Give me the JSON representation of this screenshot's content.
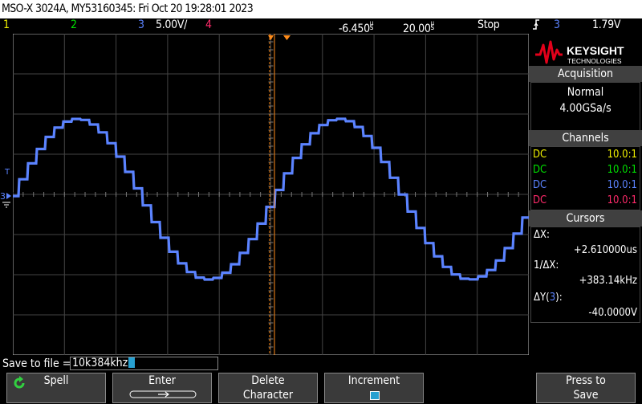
{
  "header": {
    "title": "MSO-X 3024A, MY53160345: Fri Oct 20 19:28:01 2023"
  },
  "status": {
    "ch1": "1",
    "ch2": "2",
    "ch3": "3",
    "ch3_scale": "5.00V/",
    "ch4": "4",
    "time_offset": "-6.450",
    "time_offset_unit": "s",
    "time_offset_prefix": "µ",
    "timebase": "20.00",
    "timebase_unit": "s",
    "timebase_prefix": "µ",
    "run_state": "Stop",
    "trigger_source": "3",
    "trigger_level": "1.79V"
  },
  "brand": {
    "name": "KEYSIGHT",
    "sub": "TECHNOLOGIES",
    "color": "#e2001a"
  },
  "acquisition": {
    "title": "Acquisition",
    "mode": "Normal",
    "rate": "4.00GSa/s"
  },
  "channels": {
    "title": "Channels",
    "rows": [
      {
        "coupling": "DC",
        "ratio": "10.0:1",
        "color": "#f0f000"
      },
      {
        "coupling": "DC",
        "ratio": "10.0:1",
        "color": "#00e000"
      },
      {
        "coupling": "DC",
        "ratio": "10.0:1",
        "color": "#5b83ff"
      },
      {
        "coupling": "DC",
        "ratio": "10.0:1",
        "color": "#ff2a6a"
      }
    ]
  },
  "cursors": {
    "title": "Cursors",
    "dx_label": "ΔX:",
    "dx_value": "+2.610000us",
    "inv_dx_label": "1/ΔX:",
    "inv_dx_value": "+383.14kHz",
    "dy_label_prefix": "ΔY(",
    "dy_channel": "3",
    "dy_label_suffix": "):",
    "dy_value": "-40.0000V"
  },
  "save": {
    "label": "Save to file =",
    "filename": "10k384khz"
  },
  "softkeys": {
    "spell": "Spell",
    "enter": "Enter",
    "delete_l1": "Delete",
    "delete_l2": "Character",
    "increment": "Increment",
    "press_l1": "Press to",
    "press_l2": "Save"
  },
  "colors": {
    "ch1": "#f0f000",
    "ch2": "#00e000",
    "ch3": "#5b83ff",
    "ch4": "#ff2a6a",
    "cursor": "#ff8c1a",
    "accent": "#28a0d0"
  }
}
